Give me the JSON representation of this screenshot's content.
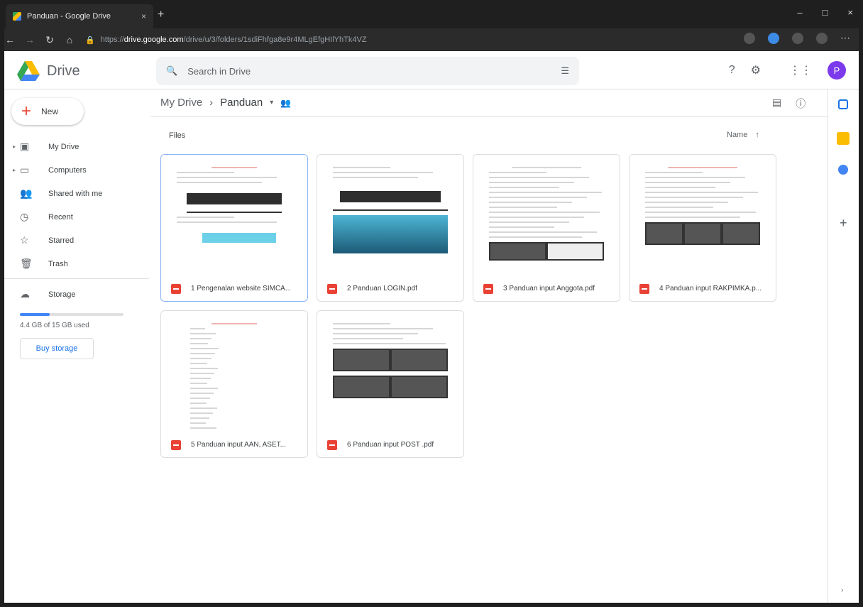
{
  "browser": {
    "tab_title": "Panduan - Google Drive",
    "tab_close": "×",
    "new_tab": "+",
    "url_prefix": "https://",
    "url_host": "drive.google.com",
    "url_path": "/drive/u/3/folders/1sdiFhfga8e9r4MLgEfgHIlYhTk4VZ",
    "window_controls": [
      "–",
      "□",
      "×"
    ]
  },
  "header": {
    "brand": "Drive",
    "search_placeholder": "Search in Drive",
    "avatar_letter": "P"
  },
  "sidebar": {
    "new_label": "New",
    "items": [
      {
        "label": "My Drive",
        "icon": "my-drive-icon",
        "glyph": "▣",
        "expandable": true
      },
      {
        "label": "Computers",
        "icon": "computer-icon",
        "glyph": "▭",
        "expandable": true
      },
      {
        "label": "Shared with me",
        "icon": "shared-icon",
        "glyph": "👥",
        "expandable": false
      },
      {
        "label": "Recent",
        "icon": "clock-icon",
        "glyph": "◷",
        "expandable": false
      },
      {
        "label": "Starred",
        "icon": "star-icon",
        "glyph": "☆",
        "expandable": false
      },
      {
        "label": "Trash",
        "icon": "trash-icon",
        "glyph": "🗑",
        "expandable": false
      }
    ],
    "storage_label": "Storage",
    "storage_used": "4.4 GB of 15 GB used",
    "storage_fraction": 0.29,
    "buy_storage": "Buy storage"
  },
  "main": {
    "breadcrumb_root": "My Drive",
    "breadcrumb_sep": "›",
    "breadcrumb_current": "Panduan",
    "breadcrumb_caret": "▾",
    "section_title": "Files",
    "sort_label": "Name",
    "sort_arrow": "↑",
    "files": [
      {
        "name": "1 Pengenalan website SIMCA...",
        "selected": true,
        "style": "a"
      },
      {
        "name": "2 Panduan LOGIN.pdf",
        "selected": false,
        "style": "b"
      },
      {
        "name": "3 Panduan input Anggota.pdf",
        "selected": false,
        "style": "c"
      },
      {
        "name": "4 Panduan input RAKPIMKA.p...",
        "selected": false,
        "style": "d"
      },
      {
        "name": "5 Panduan input AAN, ASET...",
        "selected": false,
        "style": "e"
      },
      {
        "name": "6 Panduan input POST .pdf",
        "selected": false,
        "style": "f"
      }
    ]
  },
  "colors": {
    "accent": "#1a73e8",
    "pdf_red": "#e94235",
    "avatar": "#7c3aed"
  }
}
